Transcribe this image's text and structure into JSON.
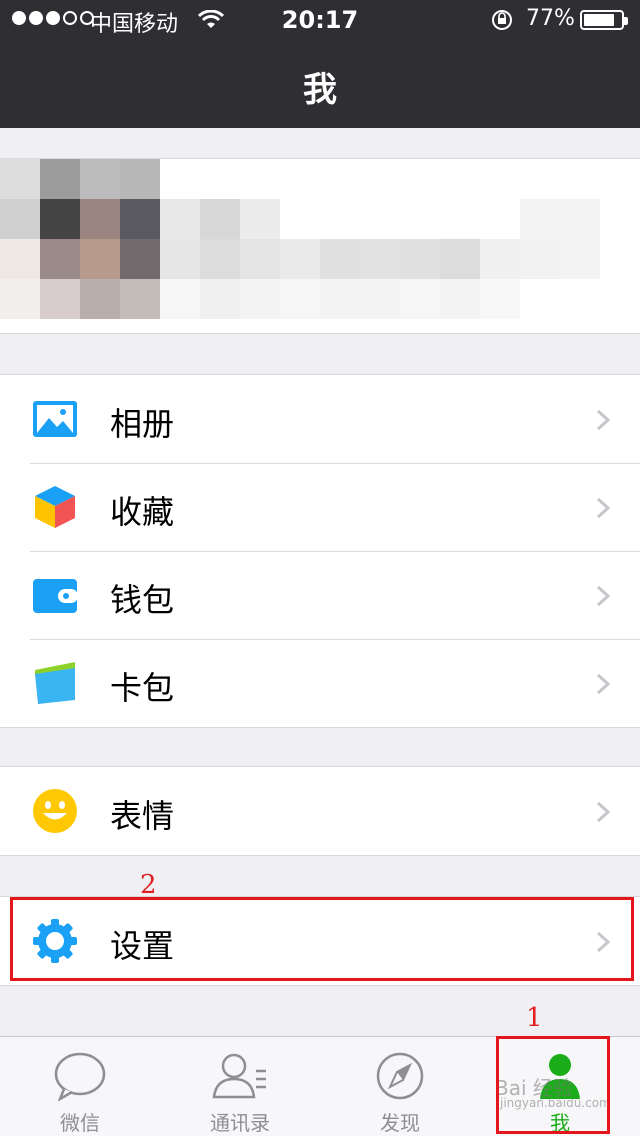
{
  "status": {
    "carrier": "中国移动",
    "time": "20:17",
    "battery": "77%",
    "battery_level": 0.77
  },
  "nav": {
    "title": "我"
  },
  "menu": {
    "group1": [
      {
        "label": "相册",
        "icon": "album-icon"
      },
      {
        "label": "收藏",
        "icon": "favorites-icon"
      },
      {
        "label": "钱包",
        "icon": "wallet-icon"
      },
      {
        "label": "卡包",
        "icon": "card-pack-icon"
      }
    ],
    "group2": [
      {
        "label": "表情",
        "icon": "sticker-smiley-icon"
      }
    ],
    "group3": [
      {
        "label": "设置",
        "icon": "settings-gear-icon"
      }
    ]
  },
  "annotations": {
    "step1": "1",
    "step2": "2"
  },
  "tabs": [
    {
      "label": "微信",
      "icon": "chat-bubble-icon",
      "active": false
    },
    {
      "label": "通讯录",
      "icon": "contacts-icon",
      "active": false
    },
    {
      "label": "发现",
      "icon": "compass-icon",
      "active": false
    },
    {
      "label": "我",
      "icon": "me-person-icon",
      "active": true
    }
  ],
  "watermark": {
    "text": "Bai 经验",
    "sub": "jingyan.baidu.com"
  },
  "colors": {
    "nav_bg": "#2e2e33",
    "accent_green": "#1aad19",
    "icon_blue": "#1aa0f5",
    "annotation_red": "#e4161b"
  }
}
